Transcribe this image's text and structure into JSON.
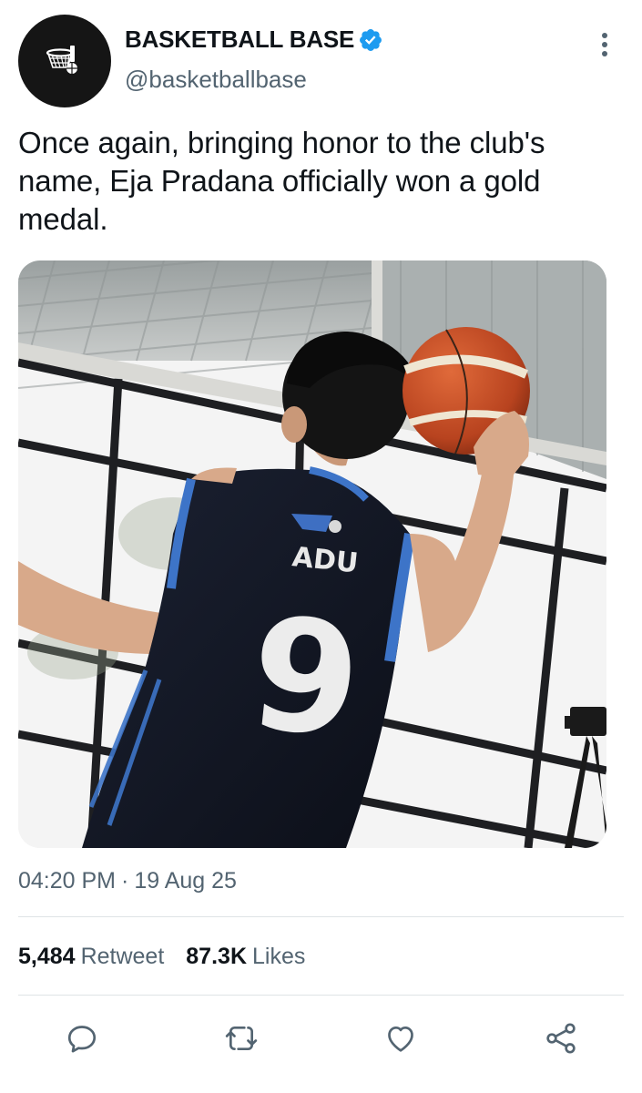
{
  "account": {
    "display_name": "BASKETBALL BASE",
    "handle": "@basketballbase",
    "verified": true,
    "avatar_icon": "basketball-hoop-icon",
    "more_icon": "more-vertical-icon"
  },
  "tweet": {
    "text": "Once again, bringing honor to the club's name, Eja Pradana officially won a gold medal.",
    "time": "04:20 PM",
    "separator": "·",
    "date": "19 Aug 25"
  },
  "media": {
    "jersey_name": "ADU",
    "jersey_number": "9"
  },
  "stats": {
    "retweets_count": "5,484",
    "retweets_label": "Retweet",
    "likes_count": "87.3K",
    "likes_label": "Likes"
  },
  "actions": {
    "reply_icon": "reply-icon",
    "retweet_icon": "retweet-icon",
    "like_icon": "heart-icon",
    "share_icon": "share-icon"
  },
  "colors": {
    "accent": "#1d9bf0",
    "text_primary": "#0f1419",
    "text_secondary": "#536471",
    "divider": "#dfe3e6",
    "avatar_bg": "#151515"
  }
}
